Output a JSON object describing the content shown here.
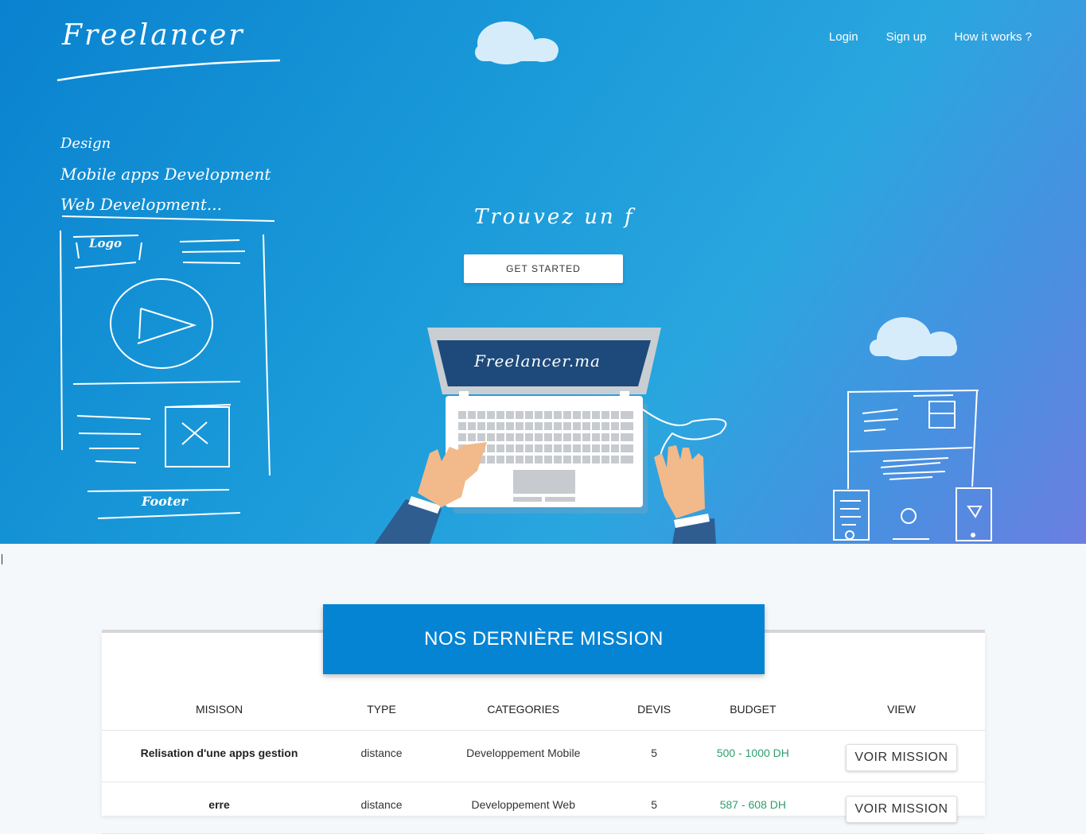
{
  "header": {
    "brand": "Freelancer",
    "nav": [
      {
        "label": "Login"
      },
      {
        "label": "Sign up"
      },
      {
        "label": "How it works ?"
      }
    ]
  },
  "hero": {
    "services": [
      "Design",
      "Mobile apps Development",
      "Web Development..."
    ],
    "sketch_logo": "Logo",
    "sketch_footer": "Footer",
    "tagline": "Trouvez un f",
    "cta_label": "GET STARTED",
    "laptop_screen_text": "Freelancer.ma"
  },
  "missions": {
    "title": "NOS DERNIÈRE MISSION",
    "columns": [
      "MISISON",
      "TYPE",
      "CATEGORIES",
      "DEVIS",
      "BUDGET",
      "VIEW"
    ],
    "rows": [
      {
        "mission": "Relisation d'une apps gestion",
        "type": "distance",
        "category": "Developpement Mobile",
        "devis": "5",
        "budget": "500 - 1000 DH",
        "action": "VOIR MISSION"
      },
      {
        "mission": "erre",
        "type": "distance",
        "category": "Developpement Web",
        "devis": "5",
        "budget": "587 - 608 DH",
        "action": "VOIR MISSION"
      }
    ]
  },
  "colors": {
    "accent": "#0584d4",
    "budget": "#2e9e6b",
    "laptop_screen": "#1d4a7a"
  }
}
